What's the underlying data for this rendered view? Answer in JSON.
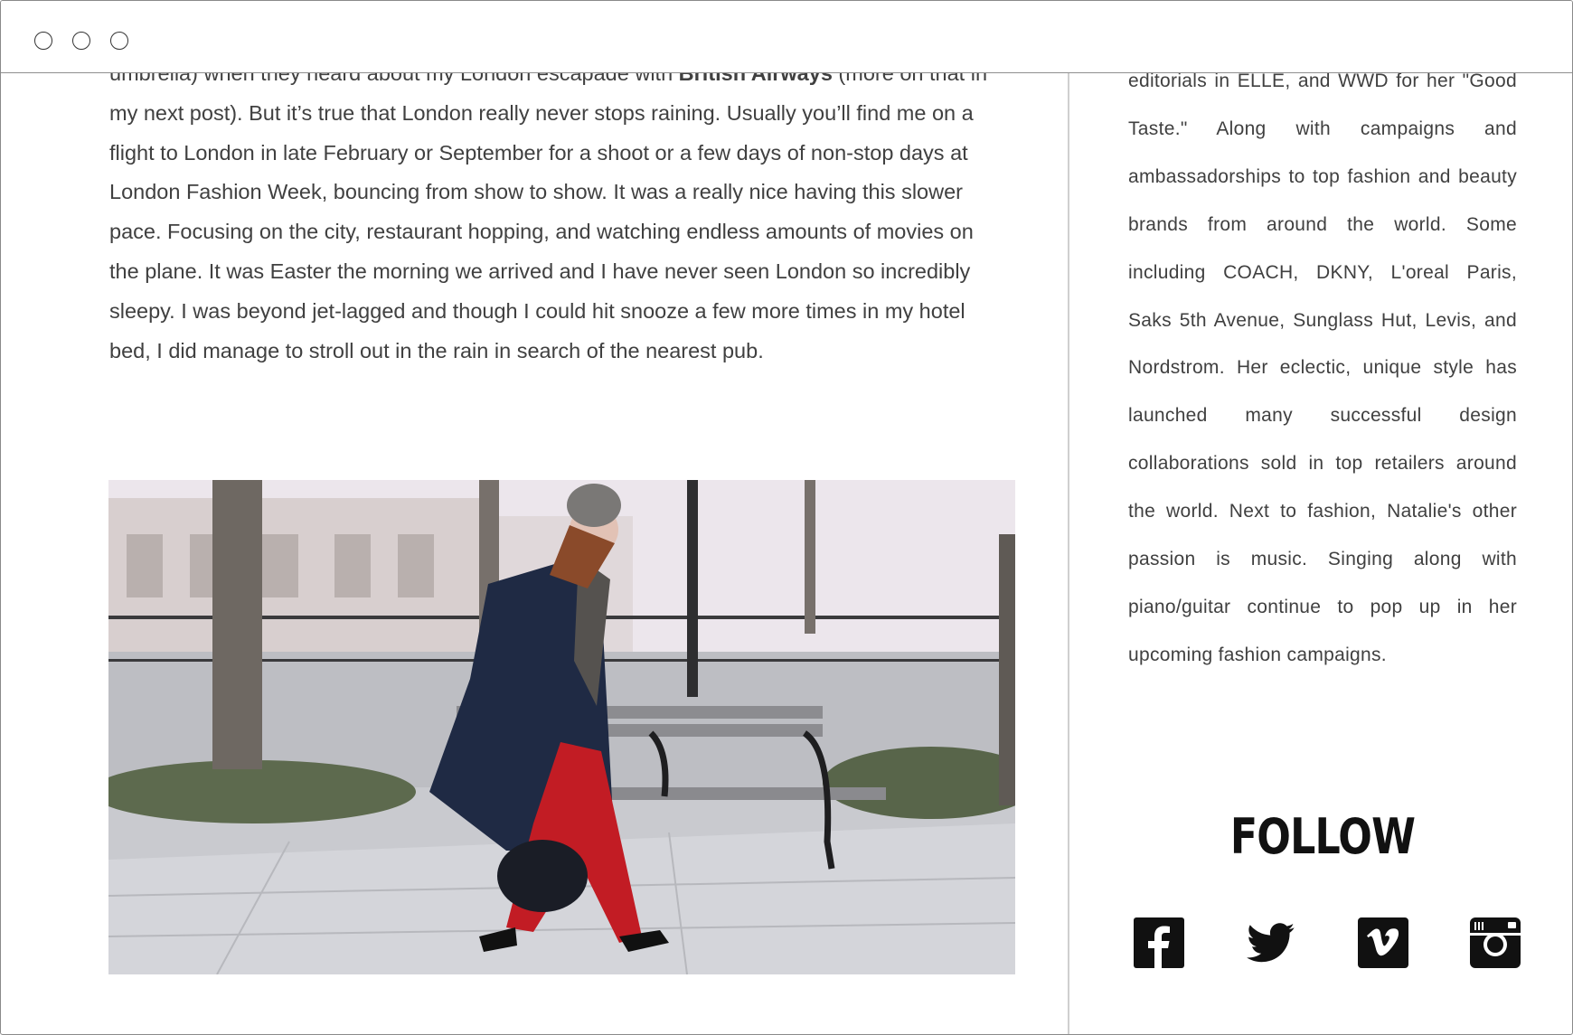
{
  "window": {
    "controls": [
      "close",
      "minimize",
      "maximize"
    ]
  },
  "post": {
    "line_top_partial": "umbrella) when they heard about my London escapade with",
    "brand_bold": "British Airways",
    "line_top_tail": "(more on",
    "paragraph": "that in my next post). But it’s true that London really never stops raining. Usually you’ll find me on a flight to London in late February or September for a shoot or a few days of non-stop days at London Fashion Week, bouncing from show to show. It was a really nice having this slower pace. Focusing on the city, restaurant hopping, and watching endless amounts of movies on the plane. It was Easter the morning we arrived and I have never seen London so incredibly sleepy. I was beyond jet-lagged and though I could hit snooze a few more times in my hotel bed, I did manage to stroll out in the rain in search of the nearest pub."
  },
  "sidebar": {
    "bio": "editorials in ELLE, and WWD for her \"Good Taste.\" Along with campaigns and ambassadorships to top fashion and beauty brands from around the world. Some including COACH, DKNY, L'oreal Paris, Saks 5th Avenue, Sunglass Hut, Levis, and Nordstrom. Her eclectic, unique style has launched many successful design collaborations sold in top retailers around the world. Next to fashion, Natalie's other passion is music. Singing along with piano/guitar continue to pop up in her upcoming fashion campaigns.",
    "follow_title": "FOLLOW",
    "social": [
      "facebook-icon",
      "twitter-icon",
      "vimeo-icon",
      "instagram-icon"
    ]
  },
  "colors": {
    "text": "#404040",
    "icon": "#111111",
    "divider": "#cfcfcf",
    "coat": "#1f2a44",
    "trousers": "#c21c24"
  }
}
